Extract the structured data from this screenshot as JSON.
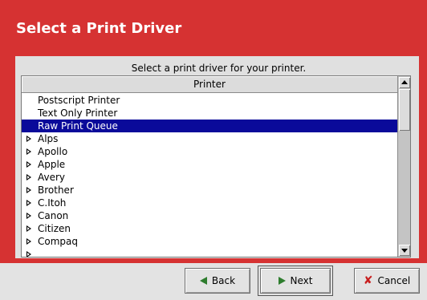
{
  "dialog": {
    "title": "Select a Print Driver",
    "caption": "Select a print driver for your printer."
  },
  "list": {
    "column_header": "Printer",
    "rows": [
      {
        "label": "Postscript Printer",
        "expandable": false,
        "selected": false
      },
      {
        "label": "Text Only Printer",
        "expandable": false,
        "selected": false
      },
      {
        "label": "Raw Print Queue",
        "expandable": false,
        "selected": true
      },
      {
        "label": "Alps",
        "expandable": true,
        "selected": false
      },
      {
        "label": "Apollo",
        "expandable": true,
        "selected": false
      },
      {
        "label": "Apple",
        "expandable": true,
        "selected": false
      },
      {
        "label": "Avery",
        "expandable": true,
        "selected": false
      },
      {
        "label": "Brother",
        "expandable": true,
        "selected": false
      },
      {
        "label": "C.Itoh",
        "expandable": true,
        "selected": false
      },
      {
        "label": "Canon",
        "expandable": true,
        "selected": false
      },
      {
        "label": "Citizen",
        "expandable": true,
        "selected": false
      },
      {
        "label": "Compaq",
        "expandable": true,
        "selected": false
      }
    ]
  },
  "buttons": {
    "back": {
      "label": "Back",
      "icon": "arrow-left-icon"
    },
    "next": {
      "label": "Next",
      "icon": "arrow-right-icon"
    },
    "cancel": {
      "label": "Cancel",
      "icon": "cancel-x-icon"
    }
  },
  "colors": {
    "banner": "#d63232",
    "selection": "#0a0a9a",
    "arrow": "#2e7d2e",
    "cancel_x": "#c81e1e"
  }
}
